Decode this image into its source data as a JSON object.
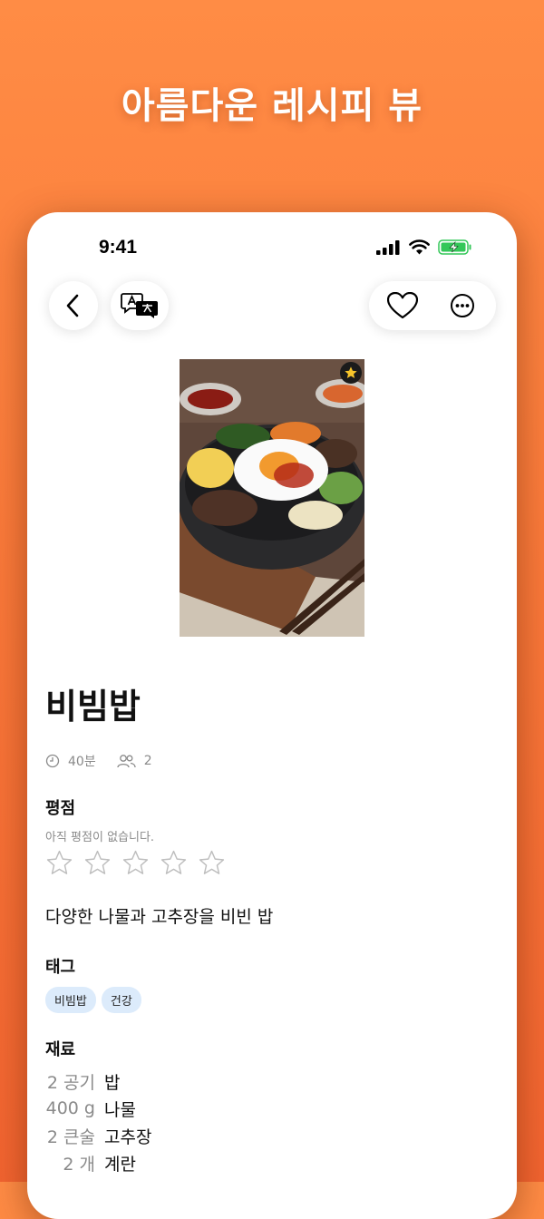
{
  "banner": {
    "title": "아름다운 레시피 뷰"
  },
  "status_bar": {
    "time": "9:41"
  },
  "nav": {
    "back_icon": "chevron-left-icon",
    "translate_icon": "translate-icon",
    "favorite_icon": "heart-icon",
    "more_icon": "more-horizontal-icon"
  },
  "recipe": {
    "title": "비빔밥",
    "time": "40분",
    "servings": "2",
    "rating_label": "평점",
    "rating_status": "아직 평점이 없습니다.",
    "rating_value": 0,
    "rating_max": 5,
    "description": "다양한 나물과 고추장을 비빈 밥",
    "tags_label": "태그",
    "tags": [
      "비빔밥",
      "건강"
    ],
    "ingredients_label": "재료",
    "ingredients": [
      {
        "qty": "2 공기",
        "name": "밥"
      },
      {
        "qty": "400 g",
        "name": "나물"
      },
      {
        "qty": "2 큰술",
        "name": "고추장"
      },
      {
        "qty": "2 개",
        "name": "계란"
      }
    ]
  },
  "colors": {
    "accent": "#f97a3b",
    "tag_bg": "#dcebfb",
    "battery": "#34c759"
  }
}
